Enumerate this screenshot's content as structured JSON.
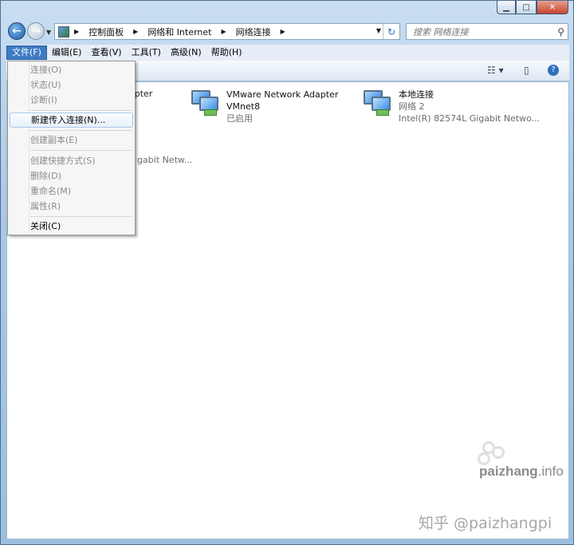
{
  "window": {
    "caption_buttons": {
      "minimize": "▁",
      "maximize": "□",
      "close": "✕"
    }
  },
  "nav": {
    "back": "←",
    "forward": "→",
    "breadcrumbs": [
      "控制面板",
      "网络和 Internet",
      "网络连接"
    ],
    "refresh": "↻"
  },
  "search": {
    "placeholder": "搜索 网络连接",
    "icon": "search-icon"
  },
  "menubar": {
    "items": [
      {
        "label": "文件(F)",
        "active": true
      },
      {
        "label": "编辑(E)"
      },
      {
        "label": "查看(V)"
      },
      {
        "label": "工具(T)"
      },
      {
        "label": "高级(N)"
      },
      {
        "label": "帮助(H)"
      }
    ]
  },
  "toolbar": {
    "views_icon": "views-icon",
    "preview_icon": "preview-pane-icon",
    "help_icon": "help-icon"
  },
  "file_menu": {
    "items": [
      {
        "label": "连接(O)",
        "enabled": false
      },
      {
        "label": "状态(U)",
        "enabled": false
      },
      {
        "label": "诊断(I)",
        "enabled": false
      },
      {
        "label": "新建传入连接(N)...",
        "enabled": true,
        "highlighted": true
      },
      {
        "label": "创建副本(E)",
        "enabled": false
      },
      {
        "label": "创建快捷方式(S)",
        "enabled": false
      },
      {
        "label": "删除(D)",
        "enabled": false
      },
      {
        "label": "重命名(M)",
        "enabled": false
      },
      {
        "label": "属性(R)",
        "enabled": false
      },
      {
        "label": "关闭(C)",
        "enabled": true
      }
    ]
  },
  "connections": [
    {
      "name_line1": "VMware Network Adapter",
      "name_line2": "VMnet8",
      "status": "已启用"
    },
    {
      "name_line1": "本地连接",
      "name_line2": "网络  2",
      "status": "Intel(R) 82574L Gigabit Netwo..."
    }
  ],
  "partial_text": {
    "adapter_tail": "apter",
    "gigabit_tail": "gabit Netw..."
  },
  "watermark": {
    "site": "paizhang",
    "tld": ".info",
    "zhihu": "知乎 @paizhangpi"
  }
}
